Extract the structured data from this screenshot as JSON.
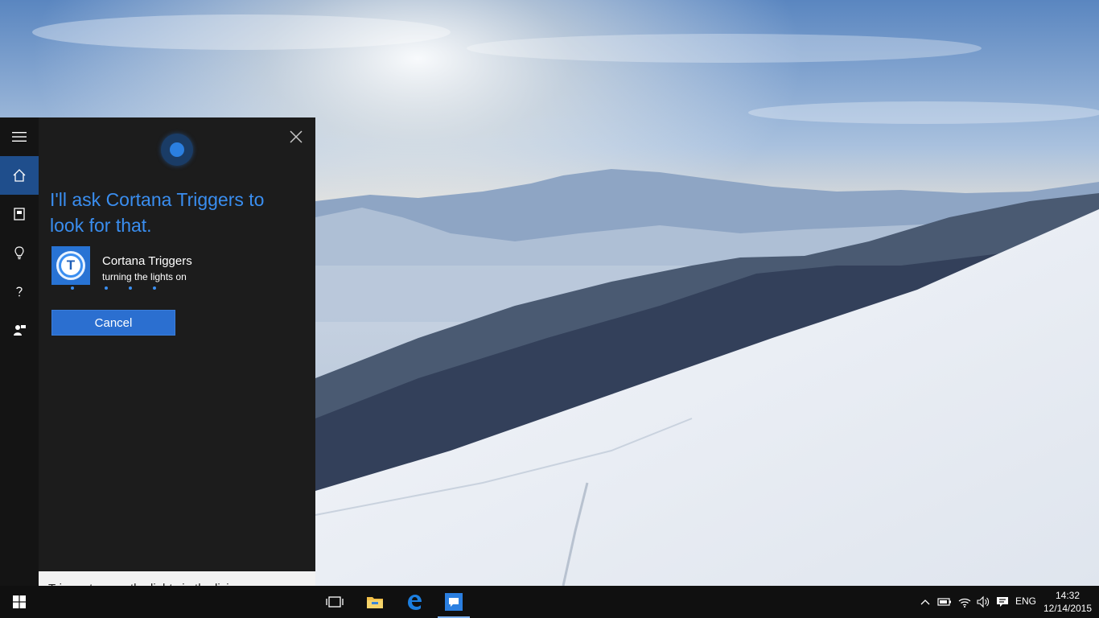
{
  "cortana": {
    "response": "I'll ask Cortana Triggers to look for that.",
    "app_name": "Cortana Triggers",
    "app_status": "turning the lights on",
    "app_logo_letter": "T",
    "cancel_label": "Cancel",
    "accent_color": "#2b6fd0",
    "rail_items": [
      "menu-icon",
      "home-icon",
      "notebook-icon",
      "lightbulb-icon",
      "help-icon",
      "feedback-icon"
    ]
  },
  "search": {
    "query": "Trigger turn on the lights in the living room"
  },
  "taskbar": {
    "pinned": [
      "task-view-icon",
      "file-explorer-icon",
      "edge-icon",
      "cortana-triggers-icon"
    ],
    "language": "ENG",
    "time": "14:32",
    "date": "12/14/2015"
  }
}
